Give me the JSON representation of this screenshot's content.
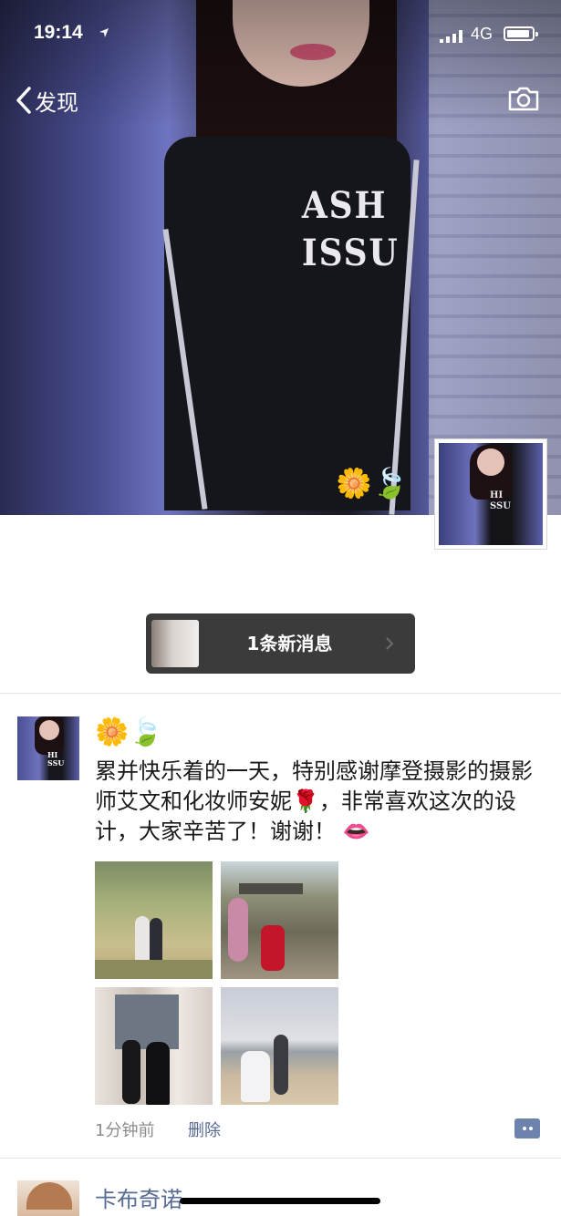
{
  "status_bar": {
    "time": "19:14",
    "network": "4G"
  },
  "nav": {
    "back_label": "发现"
  },
  "cover": {
    "shirt_text": "ASH\nISSU",
    "emojis": "🌼🍃"
  },
  "notification": {
    "label": "1条新消息"
  },
  "post": {
    "emojis": "🌼🍃",
    "text": "累并快乐着的一天，特别感谢摩登摄影的摄影师艾文和化妆师安妮🌹，非常喜欢这次的设计，大家辛苦了！谢谢！ 👄",
    "time": "1分钟前",
    "delete_label": "删除",
    "photo_count": 4
  },
  "next_post": {
    "name": "卡布奇诺"
  },
  "colors": {
    "link": "#576b95",
    "notif_bg": "#3b3b3b",
    "meta": "#8c8c8c"
  }
}
